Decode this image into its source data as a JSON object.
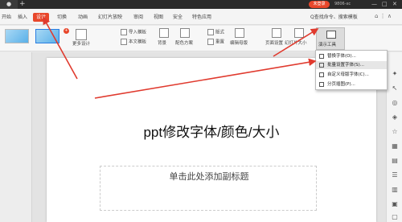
{
  "titlebar": {
    "new_tab": "+",
    "login": "未登录",
    "user_id": "9806-xc",
    "minimize": "—",
    "maximize": "□",
    "close": "✕"
  },
  "menubar": {
    "items": [
      {
        "label": "开始",
        "active": false
      },
      {
        "label": "插入",
        "active": false
      },
      {
        "label": "设计",
        "active": true
      },
      {
        "label": "切换",
        "active": false
      },
      {
        "label": "动画",
        "active": false
      },
      {
        "label": "幻灯片放映",
        "active": false
      },
      {
        "label": "审阅",
        "active": false
      },
      {
        "label": "视图",
        "active": false
      },
      {
        "label": "安全",
        "active": false
      },
      {
        "label": "特色应用",
        "active": false
      }
    ],
    "search_cmd": "Q查找命令、搜索模板"
  },
  "ribbon": {
    "more_designs": "更多设计",
    "import_template": "导入模板",
    "text_template": "本文模板",
    "background": "背景",
    "color_scheme": "配色方案",
    "layout": "版式",
    "rearrange": "重置",
    "edit_master": "编辑母版",
    "page_setup": "页面设置",
    "slide_size": "幻灯片大小",
    "present_tools": "演示工具"
  },
  "slide": {
    "title": "ppt修改字体/颜色/大小",
    "subtitle_placeholder": "单击此处添加副标题"
  },
  "dropdown": {
    "items": [
      {
        "label": "替换字体(O)...",
        "highlighted": false
      },
      {
        "label": "批量设置字体(S)...",
        "highlighted": true
      },
      {
        "label": "自定义母版字体(C)...",
        "highlighted": false
      },
      {
        "label": "分页插图(P)...",
        "highlighted": false
      }
    ]
  },
  "colors": {
    "accent": "#e8472b",
    "annotation_arrow": "#e03a2e"
  }
}
